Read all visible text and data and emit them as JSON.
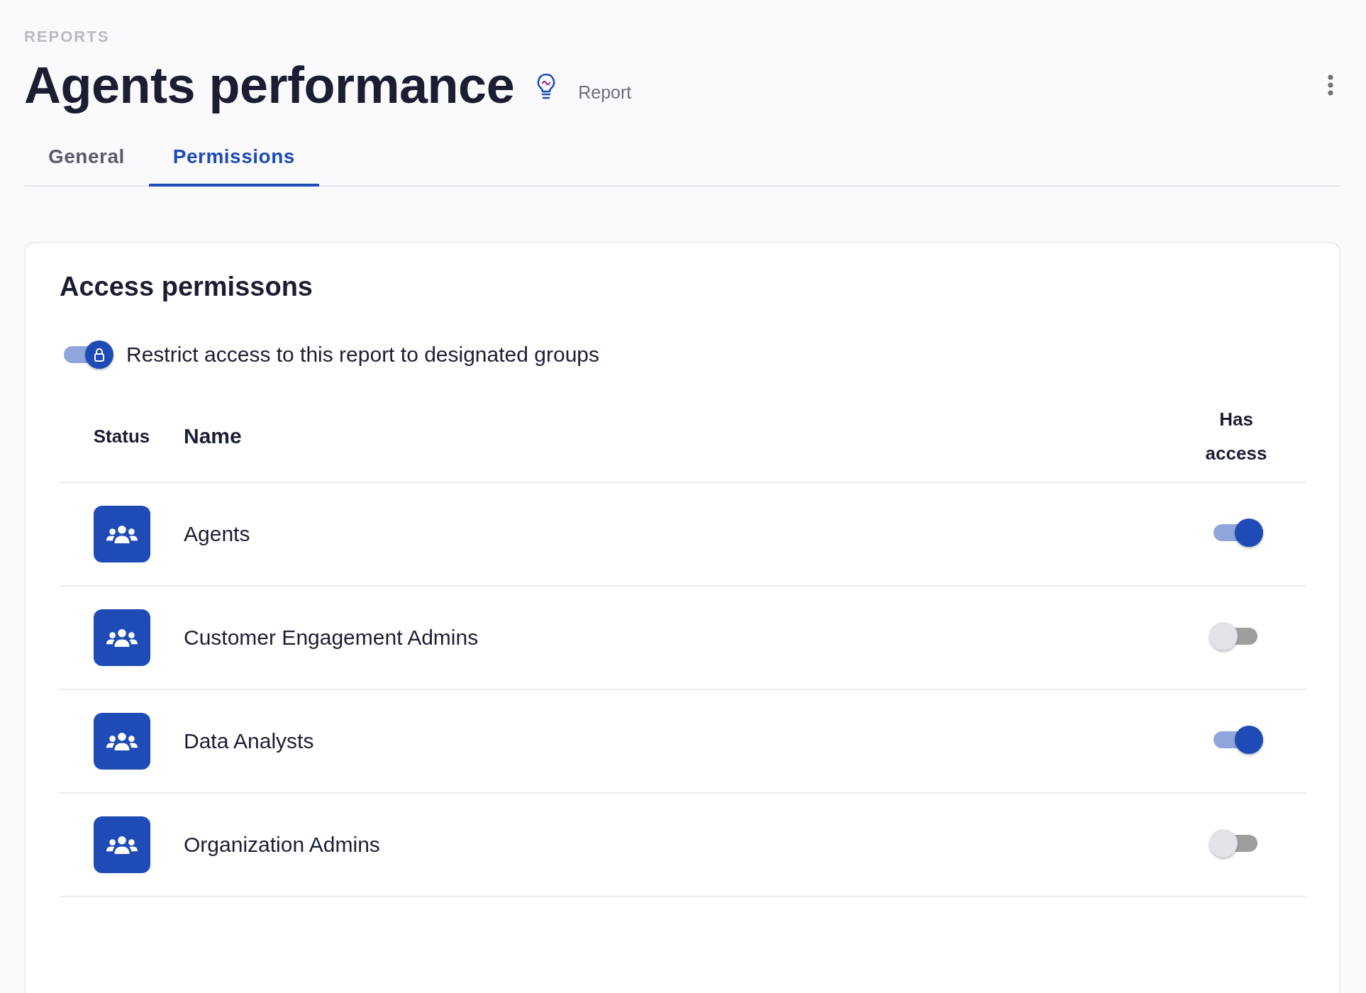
{
  "breadcrumb": "REPORTS",
  "title": "Agents performance",
  "title_tag": "Report",
  "tabs": [
    {
      "label": "General",
      "selected": false
    },
    {
      "label": "Permissions",
      "selected": true
    }
  ],
  "card": {
    "title": "Access permissons",
    "restrict": {
      "label": "Restrict access to this report to designated groups",
      "on": true
    },
    "columns": [
      "Status",
      "Name",
      "Has access"
    ],
    "groups": [
      {
        "name": "Agents",
        "has_access": true
      },
      {
        "name": "Customer Engagement Admins",
        "has_access": false
      },
      {
        "name": "Data Analysts",
        "has_access": true
      },
      {
        "name": "Organization Admins",
        "has_access": false
      }
    ]
  }
}
